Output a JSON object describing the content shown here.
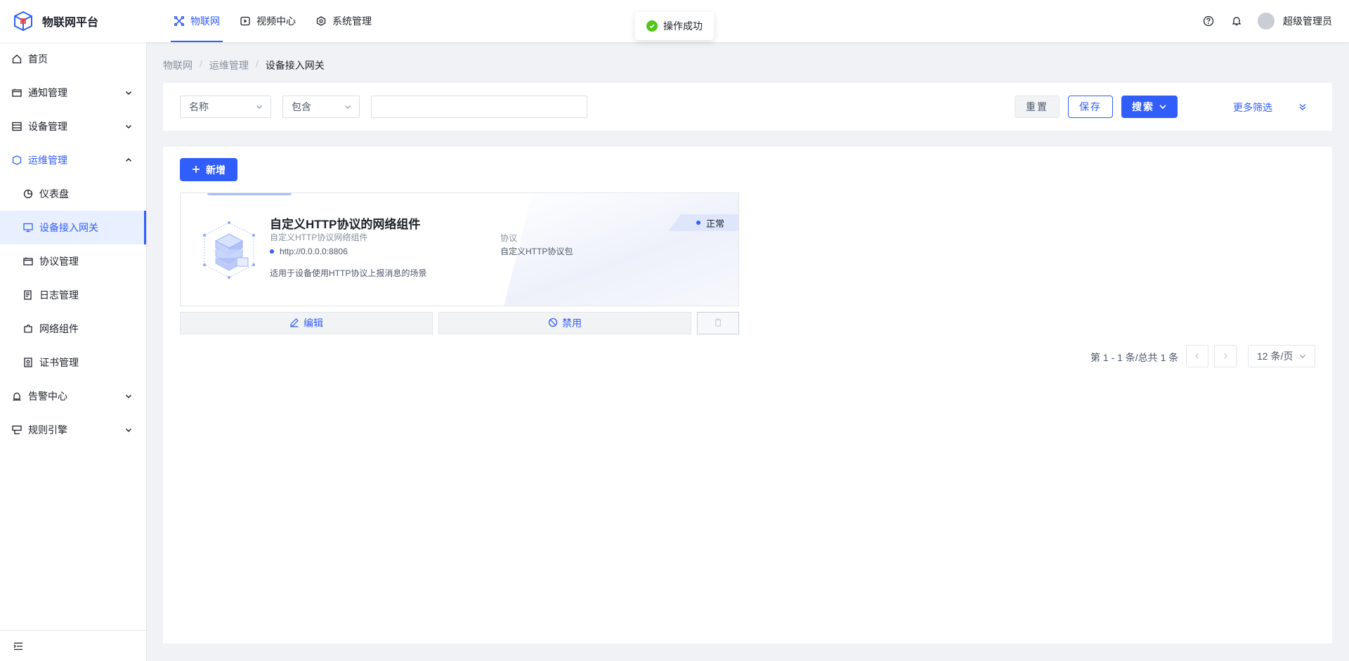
{
  "app": {
    "title": "物联网平台"
  },
  "topnav": {
    "items": [
      {
        "label": "物联网",
        "icon": "iot-icon",
        "active": true
      },
      {
        "label": "视频中心",
        "icon": "video-icon",
        "active": false
      },
      {
        "label": "系统管理",
        "icon": "settings-icon",
        "active": false
      }
    ]
  },
  "header": {
    "username": "超级管理员"
  },
  "toast": {
    "message": "操作成功"
  },
  "sidebar": {
    "items": [
      {
        "label": "首页",
        "icon": "home-icon"
      },
      {
        "label": "通知管理",
        "icon": "notice-icon",
        "expandable": true
      },
      {
        "label": "设备管理",
        "icon": "device-icon",
        "expandable": true
      },
      {
        "label": "运维管理",
        "icon": "shield-icon",
        "expandable": true,
        "open": true
      },
      {
        "label": "告警中心",
        "icon": "alarm-icon",
        "expandable": true
      },
      {
        "label": "规则引擎",
        "icon": "rule-icon",
        "expandable": true
      }
    ],
    "submenu": [
      {
        "label": "仪表盘",
        "icon": "dashboard-icon"
      },
      {
        "label": "设备接入网关",
        "icon": "monitor-icon",
        "selected": true
      },
      {
        "label": "协议管理",
        "icon": "protocol-icon"
      },
      {
        "label": "日志管理",
        "icon": "log-icon"
      },
      {
        "label": "网络组件",
        "icon": "plugin-icon"
      },
      {
        "label": "证书管理",
        "icon": "certificate-icon"
      }
    ]
  },
  "breadcrumb": {
    "items": [
      "物联网",
      "运维管理",
      "设备接入网关"
    ],
    "separator": "/"
  },
  "filter": {
    "field": "名称",
    "operator": "包含",
    "value": "",
    "reset_label": "重置",
    "save_label": "保存",
    "search_label": "搜索",
    "more_label": "更多筛选"
  },
  "toolbar": {
    "add_label": "新增"
  },
  "card": {
    "title": "自定义HTTP协议的网络组件",
    "subtitle": "自定义HTTP协议网络组件",
    "url": "http://0.0.0.0:8806",
    "description": "适用于设备使用HTTP协议上报消息的场景",
    "protocol_label": "协议",
    "protocol_value": "自定义HTTP协议包",
    "status": "正常",
    "edit_label": "编辑",
    "disable_label": "禁用"
  },
  "pagination": {
    "summary": "第 1 - 1 条/总共 1 条",
    "page_size": "12 条/页"
  },
  "colors": {
    "primary": "#315efb",
    "success": "#52c41a"
  }
}
